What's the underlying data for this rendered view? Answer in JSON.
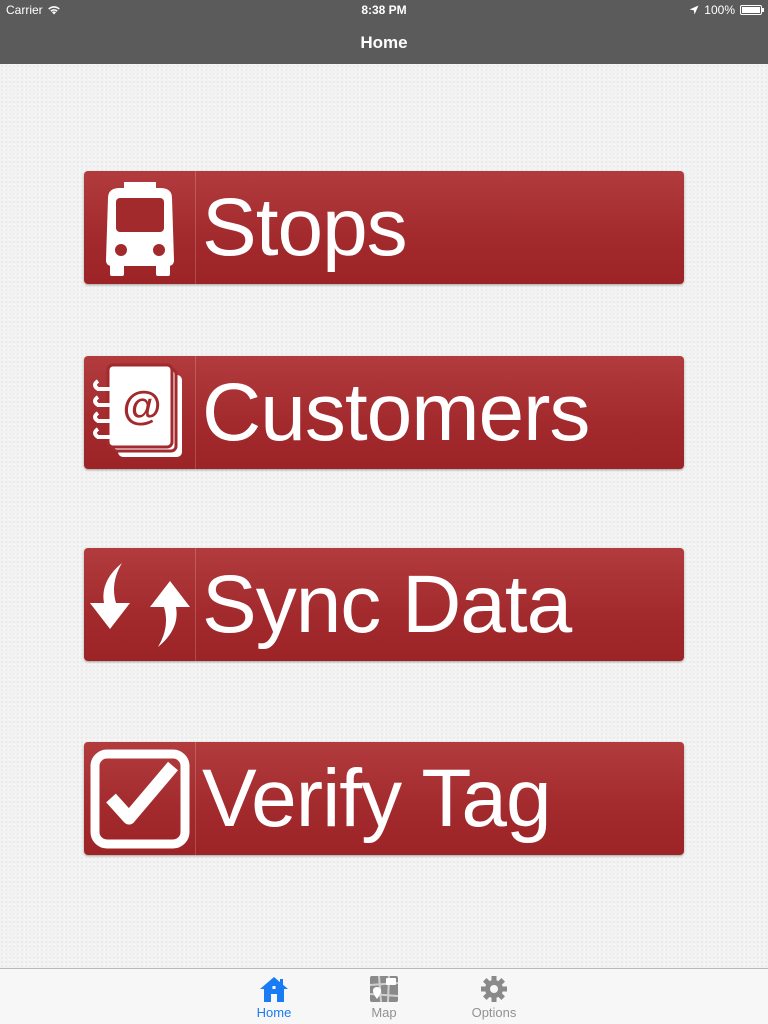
{
  "status_bar": {
    "carrier": "Carrier",
    "time": "8:38 PM",
    "battery": "100%"
  },
  "nav": {
    "title": "Home"
  },
  "menu": [
    {
      "label": "Stops",
      "icon": "bus-icon"
    },
    {
      "label": "Customers",
      "icon": "address-book-icon"
    },
    {
      "label": "Sync Data",
      "icon": "sync-arrows-icon"
    },
    {
      "label": "Verify Tag",
      "icon": "checkbox-icon"
    }
  ],
  "tabs": [
    {
      "label": "Home",
      "icon": "home-icon",
      "active": true
    },
    {
      "label": "Map",
      "icon": "map-icon",
      "active": false
    },
    {
      "label": "Options",
      "icon": "gear-icon",
      "active": false
    }
  ],
  "colors": {
    "button_red": "#a22a2d",
    "bar_gray": "#5b5b5b",
    "tab_active": "#1a7cf5",
    "tab_inactive": "#929292"
  }
}
